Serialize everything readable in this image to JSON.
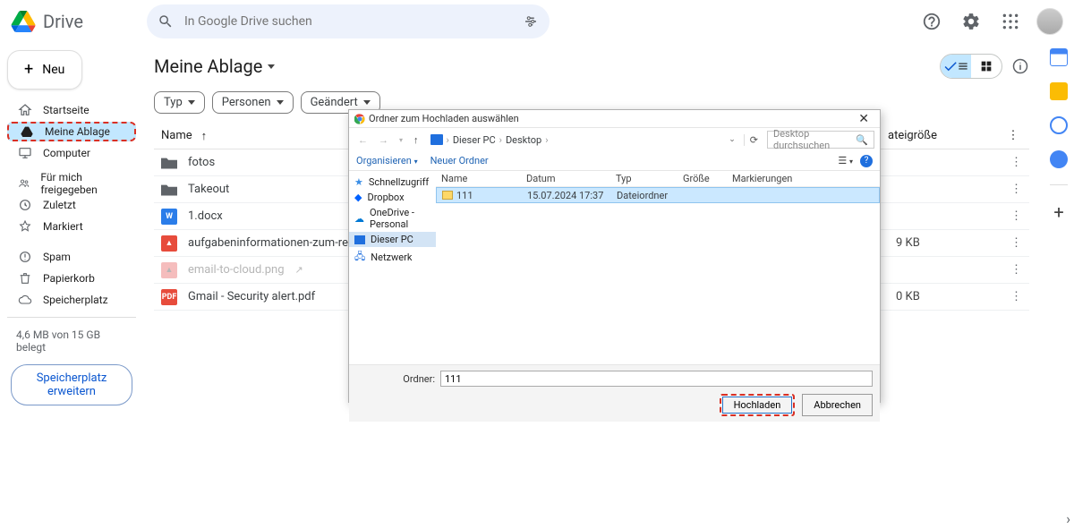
{
  "header": {
    "app_name": "Drive",
    "search_placeholder": "In Google Drive suchen"
  },
  "sidebar": {
    "new_label": "Neu",
    "items": [
      {
        "label": "Startseite"
      },
      {
        "label": "Meine Ablage"
      },
      {
        "label": "Computer"
      },
      {
        "label": "Für mich freigegeben"
      },
      {
        "label": "Zuletzt"
      },
      {
        "label": "Markiert"
      },
      {
        "label": "Spam"
      },
      {
        "label": "Papierkorb"
      },
      {
        "label": "Speicherplatz"
      }
    ],
    "storage_text": "4,6 MB von 15 GB belegt",
    "storage_btn": "Speicherplatz erweitern"
  },
  "main": {
    "title": "Meine Ablage",
    "chips": {
      "type": "Typ",
      "people": "Personen",
      "modified": "Geändert"
    },
    "cols": {
      "name": "Name",
      "size": "ateigröße"
    },
    "rows": [
      {
        "name": "fotos",
        "icon": "folder",
        "size": ""
      },
      {
        "name": "Takeout",
        "icon": "folder",
        "size": ""
      },
      {
        "name": "1.docx",
        "icon": "docx",
        "size": ""
      },
      {
        "name": "aufgabeninformationen-zum-remote-uploa",
        "icon": "img",
        "size": "9 KB"
      },
      {
        "name": "email-to-cloud.png",
        "icon": "img-faded",
        "size": "",
        "faded": true
      },
      {
        "name": "Gmail - Security alert.pdf",
        "icon": "pdf",
        "size": "0 KB"
      }
    ]
  },
  "dialog": {
    "title": "Ordner zum Hochladen auswählen",
    "crumbs": {
      "pc": "Dieser PC",
      "desktop": "Desktop"
    },
    "search_placeholder": "Desktop durchsuchen",
    "organize": "Organisieren",
    "new_folder": "Neuer Ordner",
    "side": {
      "quick": "Schnellzugriff",
      "dropbox": "Dropbox",
      "onedrive": "OneDrive - Personal",
      "thispc": "Dieser PC",
      "network": "Netzwerk"
    },
    "cols": {
      "name": "Name",
      "date": "Datum",
      "type": "Typ",
      "size": "Größe",
      "tags": "Markierungen"
    },
    "row": {
      "name": "111",
      "date": "15.07.2024 17:37",
      "type": "Dateiordner"
    },
    "folder_label": "Ordner:",
    "folder_value": "111",
    "upload": "Hochladen",
    "cancel": "Abbrechen"
  }
}
